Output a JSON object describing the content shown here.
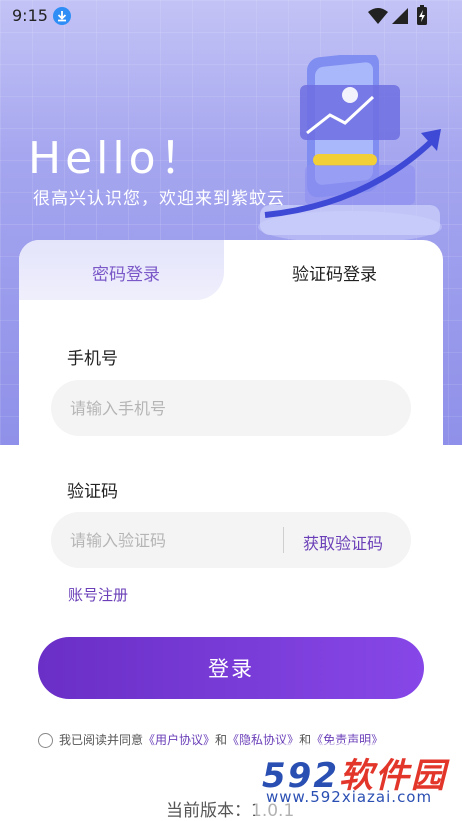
{
  "status_bar": {
    "time": "9:15"
  },
  "hero": {
    "greeting": "Hello！",
    "subtitle": "很高兴认识您，欢迎来到紫蚊云"
  },
  "tabs": [
    {
      "label": "密码登录"
    },
    {
      "label": "验证码登录"
    }
  ],
  "form": {
    "phone_label": "手机号",
    "phone_placeholder": "请输入手机号",
    "code_label": "验证码",
    "code_placeholder": "请输入验证码",
    "get_code": "获取验证码",
    "register": "账号注册",
    "login": "登录"
  },
  "agreement": {
    "prefix": "我已阅读并同意",
    "user_agreement": "《用户协议》",
    "and1": "和",
    "privacy_agreement": "《隐私协议》",
    "and2": "和",
    "disclaimer": "《免责声明》"
  },
  "version": "当前版本：1.0.1",
  "watermark": {
    "title_num": "592",
    "title_text": "软件园",
    "url": "www.592xiazai.com"
  },
  "colors": {
    "accent": "#6a3fb8",
    "button_start": "#6a2fc6",
    "button_end": "#8747e8",
    "hero": "#a5a6ef"
  }
}
